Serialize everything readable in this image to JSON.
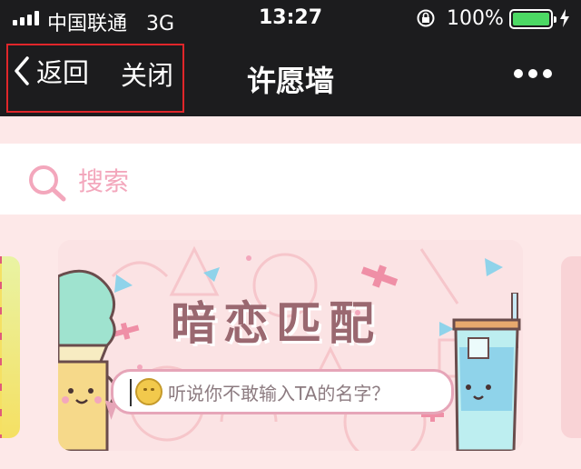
{
  "status_bar": {
    "carrier": "中国联通",
    "network": "3G",
    "time": "13:27",
    "battery_percent": "100%",
    "battery_color": "#4cd964"
  },
  "nav": {
    "back_label": "返回",
    "close_label": "关闭",
    "title": "许愿墙",
    "more_icon": "more-dots-icon",
    "highlight_color": "#e0262a"
  },
  "search": {
    "placeholder": "搜索",
    "icon": "search-icon",
    "accent": "#f3a7bc"
  },
  "banner": {
    "headline": "暗恋匹配",
    "prompt": "听说你不敢输入TA的名字？"
  }
}
